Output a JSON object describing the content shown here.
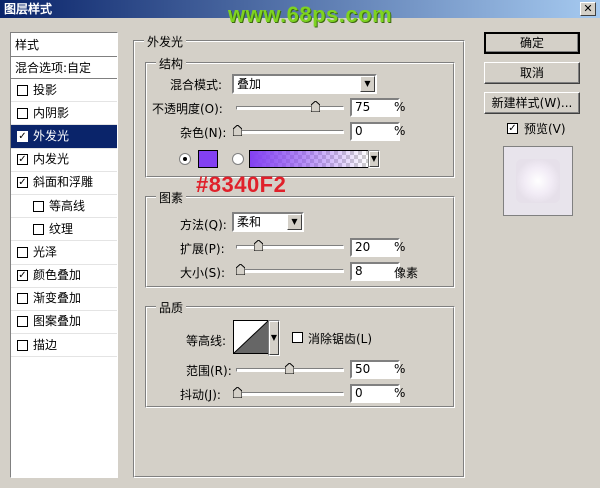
{
  "window": {
    "title": "图层样式",
    "watermark": "www.68ps.com",
    "close_glyph": "✕"
  },
  "styles_panel": {
    "header": "样式",
    "blend_options": "混合选项:自定",
    "items": [
      {
        "label": "投影",
        "checked": false,
        "indent": false,
        "selected": false
      },
      {
        "label": "内阴影",
        "checked": false,
        "indent": false,
        "selected": false
      },
      {
        "label": "外发光",
        "checked": true,
        "indent": false,
        "selected": true
      },
      {
        "label": "内发光",
        "checked": true,
        "indent": false,
        "selected": false
      },
      {
        "label": "斜面和浮雕",
        "checked": true,
        "indent": false,
        "selected": false
      },
      {
        "label": "等高线",
        "checked": false,
        "indent": true,
        "selected": false
      },
      {
        "label": "纹理",
        "checked": false,
        "indent": true,
        "selected": false
      },
      {
        "label": "光泽",
        "checked": false,
        "indent": false,
        "selected": false
      },
      {
        "label": "颜色叠加",
        "checked": true,
        "indent": false,
        "selected": false
      },
      {
        "label": "渐变叠加",
        "checked": false,
        "indent": false,
        "selected": false
      },
      {
        "label": "图案叠加",
        "checked": false,
        "indent": false,
        "selected": false
      },
      {
        "label": "描边",
        "checked": false,
        "indent": false,
        "selected": false
      }
    ]
  },
  "outer_glow": {
    "title": "外发光",
    "structure": {
      "title": "结构",
      "blend_mode_label": "混合模式:",
      "blend_mode_value": "叠加",
      "opacity_label": "不透明度(O):",
      "opacity_value": "75",
      "opacity_unit": "%",
      "opacity_level": 0.75,
      "noise_label": "杂色(N):",
      "noise_value": "0",
      "noise_unit": "%",
      "noise_level": 0.0,
      "color": "#8340f2"
    },
    "hex_annotation": "#8340F2",
    "elements": {
      "title": "图素",
      "technique_label": "方法(Q):",
      "technique_value": "柔和",
      "spread_label": "扩展(P):",
      "spread_value": "20",
      "spread_unit": "%",
      "spread_level": 0.2,
      "size_label": "大小(S):",
      "size_value": "8",
      "size_unit": "像素",
      "size_level": 0.03
    },
    "quality": {
      "title": "品质",
      "contour_label": "等高线:",
      "antialias_label": "消除锯齿(L)",
      "antialias_checked": false,
      "range_label": "范围(R):",
      "range_value": "50",
      "range_unit": "%",
      "range_level": 0.5,
      "jitter_label": "抖动(J):",
      "jitter_value": "0",
      "jitter_unit": "%",
      "jitter_level": 0.0
    }
  },
  "buttons": {
    "ok": "确定",
    "cancel": "取消",
    "new_style": "新建样式(W)...",
    "preview_label": "预览(V)",
    "preview_checked": true
  }
}
